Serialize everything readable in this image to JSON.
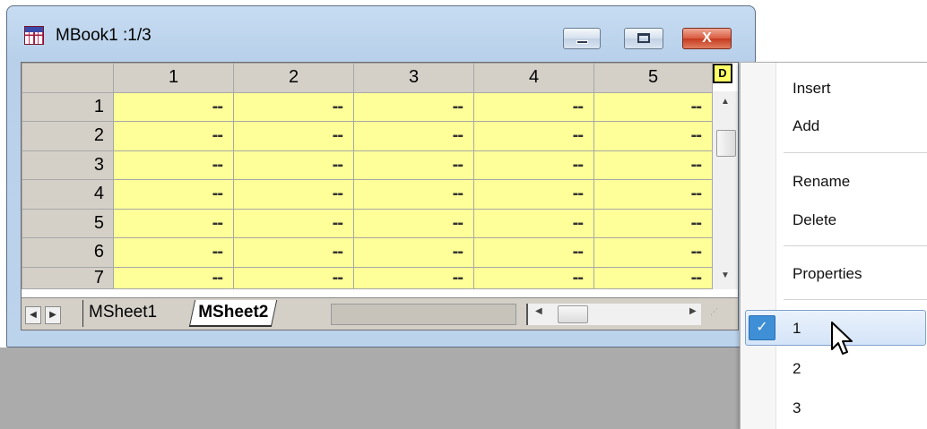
{
  "window": {
    "title": "MBook1 :1/3",
    "close_glyph": "X"
  },
  "grid": {
    "columns": [
      "1",
      "2",
      "3",
      "4",
      "5"
    ],
    "rows": [
      "1",
      "2",
      "3",
      "4",
      "5",
      "6",
      "7"
    ],
    "cell_value": "--",
    "d_button": "D"
  },
  "sheet_tabs": [
    {
      "label": "MSheet1",
      "active": false
    },
    {
      "label": "MSheet2",
      "active": true
    }
  ],
  "context_menu": {
    "items": [
      "Insert",
      "Add",
      "Rename",
      "Delete",
      "Properties"
    ],
    "sheet_choices": [
      "1",
      "2",
      "3"
    ],
    "checked_choice": "1",
    "check_glyph": "✓"
  },
  "colors": {
    "cell_bg": "#ffff99",
    "header_bg": "#d4d0c8",
    "highlight": "#3f8fd6"
  },
  "icons": [
    "worksheet-icon",
    "minimize-icon",
    "maximize-icon",
    "close-icon",
    "scroll-up-icon",
    "scroll-down-icon",
    "scroll-left-icon",
    "scroll-right-icon",
    "check-icon",
    "mouse-cursor-icon"
  ]
}
